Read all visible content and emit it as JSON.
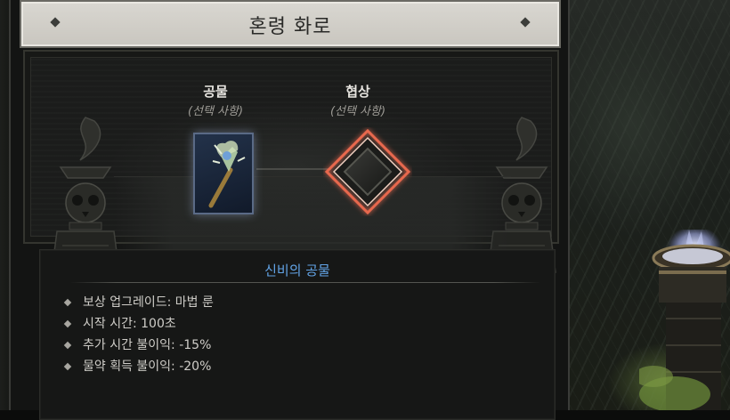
{
  "window": {
    "title": "혼령 화로"
  },
  "slots": {
    "tribute": {
      "name": "공물",
      "sub": "(선택 사항)"
    },
    "pact": {
      "name": "협상",
      "sub": "(선택 사항)"
    }
  },
  "info": {
    "title": "신비의 공물",
    "items": [
      "보상 업그레이드: 마법 룬",
      "시작 시간: 100초",
      "추가 시간 불이익: -15%",
      "물약 획득 불이익: -20%"
    ]
  },
  "colors": {
    "info_title": "#62a3e5",
    "pact_glow": "#e8684e",
    "title_bar": "#d9d7d1"
  },
  "icons": [
    "tribute-card-icon",
    "pact-diamond-icon",
    "skull-statue-icon",
    "brazier-icon"
  ]
}
